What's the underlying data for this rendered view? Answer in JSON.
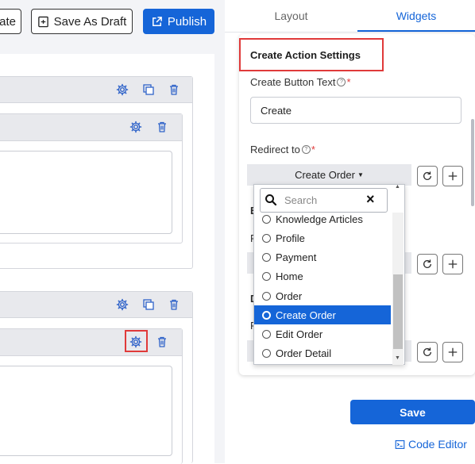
{
  "toolbar": {
    "update_label": "ate",
    "save_draft_label": "Save As Draft",
    "publish_label": "Publish"
  },
  "tabs": [
    {
      "label": "Layout",
      "active": false
    },
    {
      "label": "Widgets",
      "active": true
    }
  ],
  "settings": {
    "title": "Create Action Settings",
    "create_button_text_label": "Create Button Text",
    "create_button_text_value": "Create",
    "redirect_label": "Redirect to",
    "redirect_value": "Create Order",
    "hidden_label_1": "E",
    "hidden_label_2": "R",
    "hidden_label_3": "D",
    "hidden_label_4": "R"
  },
  "dropdown": {
    "search_placeholder": "Search",
    "options": [
      {
        "label": "Knowledge Articles",
        "selected": false
      },
      {
        "label": "Profile",
        "selected": false
      },
      {
        "label": "Payment",
        "selected": false
      },
      {
        "label": "Home",
        "selected": false
      },
      {
        "label": "Order",
        "selected": false
      },
      {
        "label": "Create Order",
        "selected": true
      },
      {
        "label": "Edit Order",
        "selected": false
      },
      {
        "label": "Order Detail",
        "selected": false
      }
    ]
  },
  "footer": {
    "save_label": "Save",
    "code_editor_label": "Code Editor"
  },
  "colors": {
    "accent": "#1565d8",
    "highlight": "#e03a3a"
  }
}
